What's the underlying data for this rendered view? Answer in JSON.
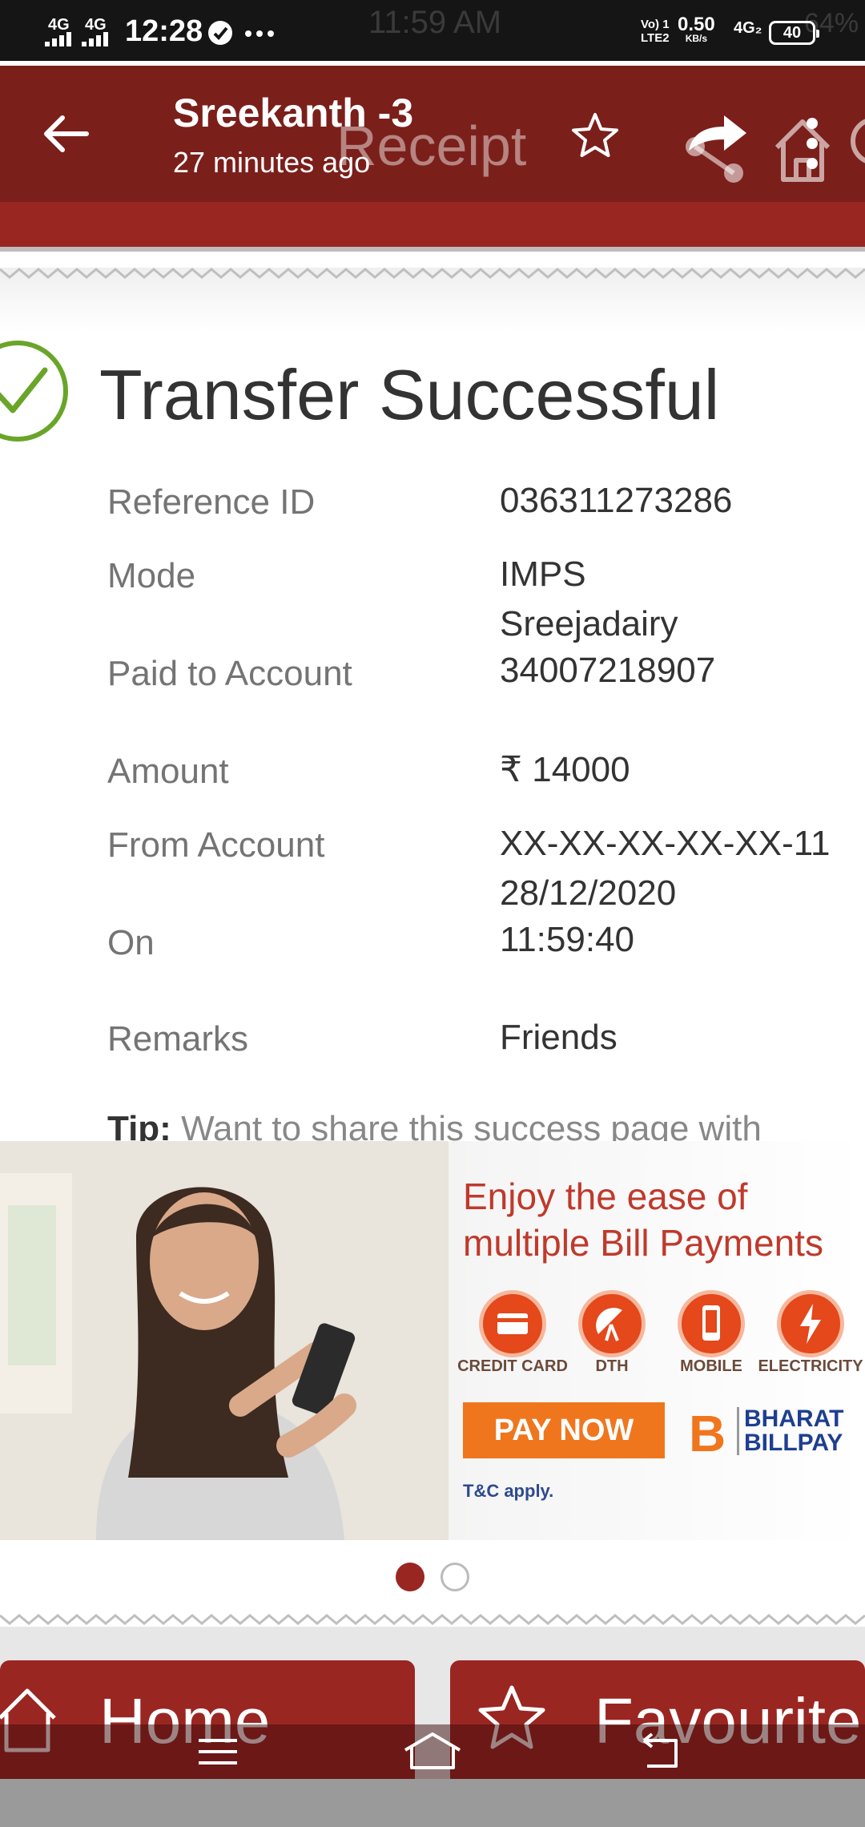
{
  "status_bar": {
    "time": "12:28",
    "ghost_time": "11:59 AM",
    "signal_1": "4G",
    "signal_2": "4G",
    "net_rate": "0.50",
    "net_unit": "KB/s",
    "volte": "Vo) 1",
    "lte": "LTE2",
    "network_2": "4G₂",
    "battery": "40",
    "ghost_battery": "64%"
  },
  "app_bar": {
    "title": "Sreekanth -3",
    "subtitle": "27 minutes ago",
    "ghost_title": "Receipt"
  },
  "receipt": {
    "headline": "Transfer Successful",
    "rows": [
      {
        "label": "Reference ID",
        "value": "036311273286"
      },
      {
        "label": "Mode",
        "value": "IMPS"
      },
      {
        "label": "Paid to Account",
        "value_line1": "Sreejadairy",
        "value_line2": "34007218907"
      },
      {
        "label": "Amount",
        "value": "₹ 14000"
      },
      {
        "label": "From Account",
        "value": "XX-XX-XX-XX-XX-11"
      },
      {
        "label": "On",
        "value_line1": "28/12/2020",
        "value_line2": "11:59:40"
      },
      {
        "label": "Remarks",
        "value": "Friends"
      }
    ],
    "tip_label": "Tip:",
    "tip_text": "Want to share this success page with"
  },
  "banner": {
    "line1": "Enjoy the ease of",
    "line2": "multiple Bill Payments",
    "categories": [
      "CREDIT CARD",
      "DTH",
      "MOBILE",
      "ELECTRICITY"
    ],
    "cta": "PAY NOW",
    "brand_letter": "B",
    "brand_line1": "BHARAT",
    "brand_line2": "BILLPAY",
    "terms": "T&C apply.",
    "active_slide": 1,
    "slide_count": 2
  },
  "bottom_buttons": {
    "home": "Home",
    "favourite": "Favourite"
  },
  "colors": {
    "app_bar": "#7b1f1b",
    "accent_red": "#9a2622",
    "success_green": "#6aa52a",
    "banner_orange": "#f0761e"
  }
}
